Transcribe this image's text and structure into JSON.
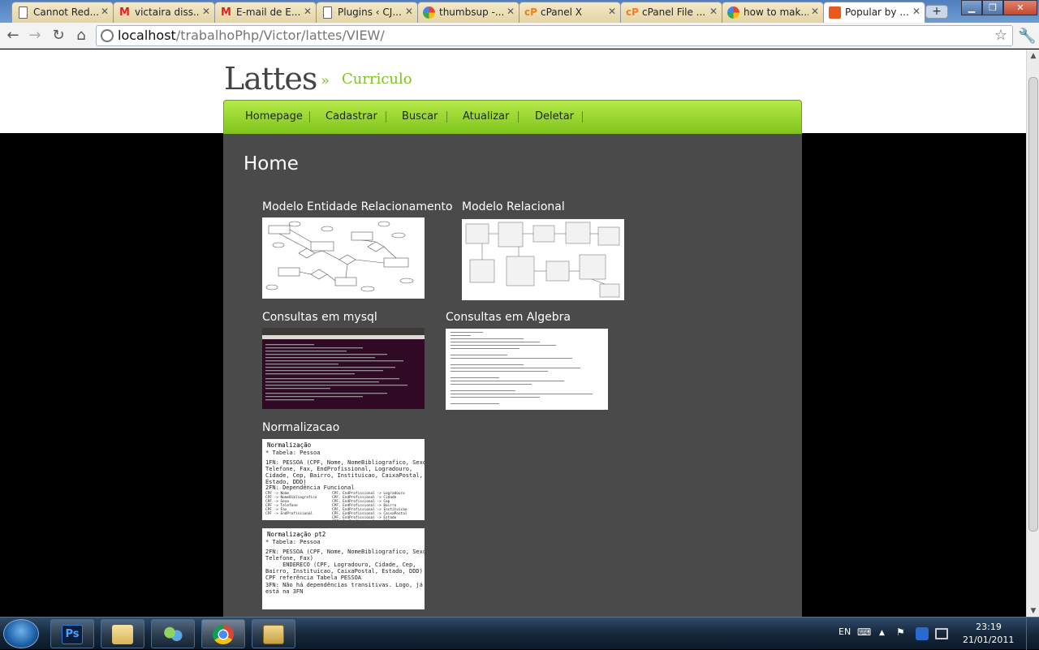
{
  "browser": {
    "tabs": [
      {
        "label": "Cannot Red...",
        "icon": "document-icon"
      },
      {
        "label": "victaira diss...",
        "icon": "gmail-icon"
      },
      {
        "label": "E-mail de E...",
        "icon": "gmail-icon"
      },
      {
        "label": "Plugins ‹ CJ...",
        "icon": "document-icon"
      },
      {
        "label": "thumbsup -...",
        "icon": "google-icon"
      },
      {
        "label": "cPanel X",
        "icon": "cpanel-icon"
      },
      {
        "label": "cPanel File ...",
        "icon": "cpanel-icon"
      },
      {
        "label": "how to mak...",
        "icon": "google-icon"
      },
      {
        "label": "Popular by ...",
        "icon": "popular-icon"
      }
    ],
    "active_tab": 8,
    "address": {
      "host": "localhost",
      "path": "/trabalhoPhp/Victor/lattes/VIEW/"
    }
  },
  "page": {
    "site_title": "Lattes",
    "separator": "»",
    "subtitle": "Curriculo",
    "nav": [
      "Homepage",
      "Cadastrar",
      "Buscar",
      "Atualizar",
      "Deletar"
    ],
    "heading": "Home",
    "gallery": [
      {
        "caption": "Modelo Entidade Relacionamento",
        "kind": "er-diagram"
      },
      {
        "caption": "Modelo Relacional",
        "kind": "relational-diagram"
      },
      {
        "caption": "Consultas em mysql",
        "kind": "terminal"
      },
      {
        "caption": "Consultas em Algebra",
        "kind": "algebra-doc"
      },
      {
        "caption": "Normalizacao",
        "kind": "normalization-doc"
      }
    ],
    "norm1": {
      "title": "Normalização",
      "table": "* Tabela: Pessoa",
      "fn1": "1FN: PESSOA (CPF, Nome, NomeBibliografico, Sexo,\nTelefone, Fax, EndProfissional, Logradouro,\nCidade, Cep, Bairro, Instituicao, CaixaPostal,\nEstado, DDD)",
      "fn2": "2FN: Dependência Funcional",
      "deps": "CPF -> Nome                    CPF, EndProfissional -> Logradouro\nCPF -> NomeBibliografico       CPF, EndProfissional -> Cidade\nCPF -> Sexo                    CPF, EndProfissional -> Cep\nCPF -> Telefone                CPF, EndProfissional -> Bairro\nCPF -> Fax                     CPF, EndProfissional -> Instituicao\nCPF -> EndProfissional         CPF, EndProfissional -> CaixaPostal\n                               CPF, EndProfissional -> Estado\n                               CPF, EndProfissional -> DDD"
    },
    "norm2": {
      "title": "Normalização pt2",
      "table": "* Tabela: Pessoa",
      "fn2": "2FN: PESSOA (CPF, Nome, NomeBibliografico, Sexo,\nTelefone, Fax)\n     ENDERECO (CPF, Logradouro, Cidade, Cep,\nBairro, Instituicao, CaixaPostal, Estado, DDD)\nCPF referência Tabela PESSOA",
      "fn3": "3FN: Não há dependências transitivas. Logo, já\nestá na 3FN"
    }
  },
  "taskbar": {
    "apps": [
      "photoshop-icon",
      "folder-libraries-icon",
      "users-icon",
      "chrome-icon",
      "file-manager-icon"
    ],
    "language": "EN",
    "time": "23:19",
    "date": "21/01/2011"
  },
  "colors": {
    "accent_green": "#7fc31c",
    "content_bg": "#4a4a4a",
    "page_bg": "#000000"
  }
}
